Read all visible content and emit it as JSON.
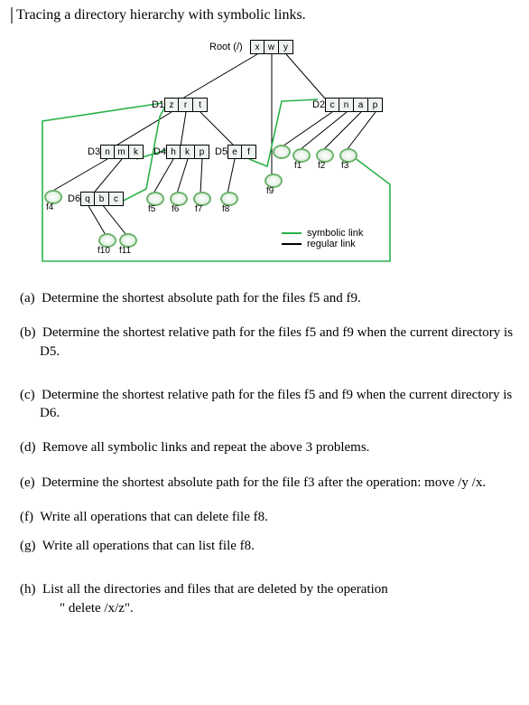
{
  "title": "Tracing a directory hierarchy with symbolic links.",
  "diagram": {
    "root_label": "Root (/)",
    "root_cells": [
      "x",
      "w",
      "y"
    ],
    "D1_label": "D1",
    "D1_cells": [
      "z",
      "r",
      "t"
    ],
    "D2_label": "D2",
    "D2_cells": [
      "c",
      "n",
      "a",
      "p"
    ],
    "D3_label": "D3",
    "D3_cells": [
      "n",
      "m",
      "k"
    ],
    "D4_label": "D4",
    "D4_cells": [
      "h",
      "k",
      "p"
    ],
    "D5_label": "D5",
    "D5_cells": [
      "e",
      "f"
    ],
    "D6_label": "D6",
    "D6_cells": [
      "q",
      "b",
      "c"
    ],
    "files": {
      "f1": "f1",
      "f2": "f2",
      "f3": "f3",
      "f4": "f4",
      "f5": "f5",
      "f6": "f6",
      "f7": "f7",
      "f8": "f8",
      "f9": "f9",
      "f10": "f10",
      "f11": "f11"
    }
  },
  "legend": {
    "sym": "symbolic link",
    "reg": "regular link"
  },
  "questions": {
    "a": {
      "mark": "(a)",
      "text": "Determine the shortest absolute path for the files f5 and f9."
    },
    "b": {
      "mark": "(b)",
      "text": "Determine the shortest relative path for the files f5 and f9 when the current directory is D5."
    },
    "c": {
      "mark": "(c)",
      "text": "Determine the shortest relative path for the files f5 and f9 when the current directory is D6."
    },
    "d": {
      "mark": "(d)",
      "text": "Remove all symbolic links and repeat the above 3 problems."
    },
    "e": {
      "mark": "(e)",
      "text": "Determine the shortest absolute path for the file f3 after the operation: move /y /x."
    },
    "f": {
      "mark": "(f)",
      "text": "Write all operations that can delete file f8."
    },
    "g": {
      "mark": "(g)",
      "text": "Write all operations that can list file f8."
    },
    "h": {
      "mark": "(h)",
      "text": "List all the directories and files that are deleted by the operation",
      "sub": "\" delete /x/z\"."
    }
  }
}
